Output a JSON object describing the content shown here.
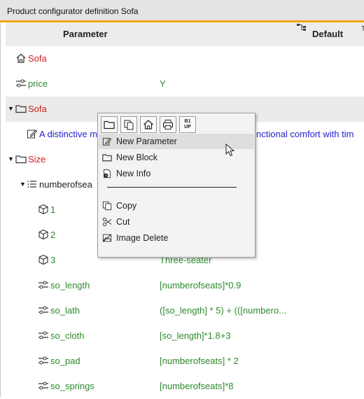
{
  "window": {
    "title": "Product configurator definition Sofa"
  },
  "columns": {
    "parameter": "Parameter",
    "default": "Default"
  },
  "rows": [
    {
      "label": "Sofa",
      "value": ""
    },
    {
      "label": "price",
      "value": "Y"
    },
    {
      "label": "Sofa",
      "value": ""
    },
    {
      "label": "A distinctive m",
      "value": "nctional comfort with tim"
    },
    {
      "label": "Size",
      "value": ""
    },
    {
      "label": "numberofsea",
      "value": ""
    },
    {
      "label": "1",
      "value": ""
    },
    {
      "label": "2",
      "value": ""
    },
    {
      "label": "3",
      "value": "Three-seater"
    },
    {
      "label": "so_length",
      "value": "[numberofseats]*0.9"
    },
    {
      "label": "so_lath",
      "value": "([so_length] * 5) + (([numbero..."
    },
    {
      "label": "so_cloth",
      "value": "[so_length]*1.8+3"
    },
    {
      "label": "so_pad",
      "value": "[numberofseats] * 2"
    },
    {
      "label": "so_springs",
      "value": "[numberofseats]*8"
    }
  ],
  "context_menu": {
    "toolbar": [
      {
        "icon": "folder-icon"
      },
      {
        "icon": "copy-pages-icon"
      },
      {
        "icon": "home-icon"
      },
      {
        "icon": "print-icon"
      },
      {
        "icon": "two-up-icon",
        "text_top": "B1",
        "text_bottom": "UP"
      }
    ],
    "items": [
      {
        "label": "New Parameter",
        "icon": "edit-icon"
      },
      {
        "label": "New Block",
        "icon": "folder-icon"
      },
      {
        "label": "New Info",
        "icon": "info-icon"
      },
      {
        "label": "Copy",
        "icon": "copy-icon"
      },
      {
        "label": "Cut",
        "icon": "scissors-icon"
      },
      {
        "label": "Image Delete",
        "icon": "image-delete-icon"
      }
    ]
  },
  "colors": {
    "accent": "#f2a516",
    "label_red": "#d01f1f",
    "label_green": "#2d8a2d",
    "label_blue": "#2222cc"
  }
}
